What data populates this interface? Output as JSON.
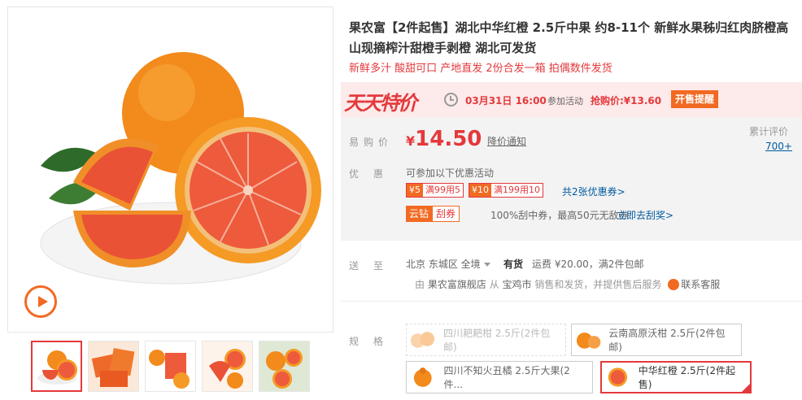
{
  "product": {
    "title": "果农富【2件起售】湖北中华红橙 2.5斤中果 约8-11个 新鲜水果秭归红肉脐橙高山现摘榨汁甜橙手剥橙 湖北可发货",
    "subtitle": "新鲜多汁 酸甜可口 产地直发 2份合发一箱 拍偶数件发货"
  },
  "gallery": {
    "thumbnails": [
      "thumb-1",
      "thumb-2",
      "thumb-3",
      "thumb-4",
      "thumb-5"
    ],
    "selected_index": 0
  },
  "banner": {
    "logo": "天天特价",
    "time": "03月31日 16:00",
    "text": "参加活动",
    "seckill": "抢购价:¥13.60",
    "remind_label": "开售提醒"
  },
  "price": {
    "label": "易购价",
    "currency": "¥",
    "value": "14.50",
    "notify": "降价通知",
    "review_label": "累计评价",
    "review_count": "700+"
  },
  "promo": {
    "label": "优惠",
    "desc": "可参加以下优惠活动",
    "coupons": [
      {
        "amount": "¥5",
        "condition": "满99用5"
      },
      {
        "amount": "¥10",
        "condition": "满199用10"
      }
    ],
    "more_coupons": "共2张优惠券>",
    "yunzuan_tag": "云钻",
    "yunzuan_type": "刮券",
    "yunzuan_desc": "100%刮中券，最高50元无敌券",
    "yunzuan_link": "立即去刮奖>"
  },
  "shipping": {
    "label": "送至",
    "location": "北京 东城区 全境",
    "stock": "有货",
    "fee": "运费 ¥20.00，满2件包邮",
    "seller_prefix": "由",
    "seller_name": "果农富旗舰店",
    "seller_mid": "从",
    "seller_origin": "宝鸡市",
    "seller_suffix": "销售和发货，并提供售后服务",
    "cs_label": "联系客服"
  },
  "specs": {
    "label": "规格",
    "options": [
      {
        "label": "四川耙耙柑 2.5斤(2件包邮)",
        "state": "disabled"
      },
      {
        "label": "云南高原沃柑 2.5斤(2件包邮)",
        "state": "normal"
      },
      {
        "label": "四川不知火丑橘 2.5斤大果(2件...",
        "state": "normal"
      },
      {
        "label": "中华红橙 2.5斤(2件起售)",
        "state": "selected"
      }
    ]
  },
  "colors": {
    "accent_red": "#e4393c",
    "accent_orange": "#f26a22",
    "link_blue": "#005aa0"
  }
}
